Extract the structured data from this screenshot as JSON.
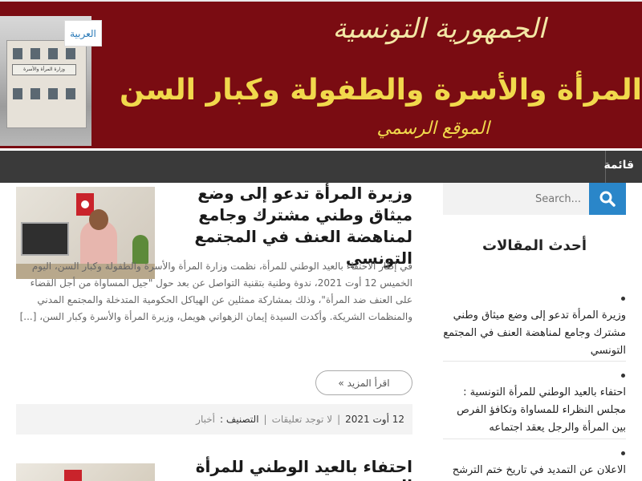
{
  "header": {
    "lang_button": "العربية",
    "title_line1": "الجمهورية التونسية",
    "title_line2": "المرأة والأسرة والطفولة وكبار السن",
    "title_line3": "الموقع الرسمي",
    "building_sign": "وزارة المرأة والأسرة"
  },
  "nav": {
    "menu_label": "قائمة"
  },
  "search": {
    "placeholder": "Search..."
  },
  "sidebar": {
    "heading": "أحدث المقالات",
    "items": [
      {
        "label": "وزيرة المرأة تدعو إلى وضع ميثاق وطني مشترك وجامع لمناهضة العنف في المجتمع التونسي"
      },
      {
        "label": "احتفاء بالعيد الوطني للمرأة التونسية : مجلس النظراء للمساواة وتكافؤ الفرص بين المرأة والرجل يعقد اجتماعه"
      },
      {
        "label": "الاعلان عن التمديد في تاريخ ختم الترشح"
      }
    ]
  },
  "articles": [
    {
      "title": "وزيرة المرأة تدعو إلى وضع ميثاق وطني مشترك وجامع لمناهضة العنف في المجتمع التونسي",
      "excerpt": "في إطار الاحتفاء بالعيد الوطني للمرأة، نظمت وزارة المرأة والأسرة والطفولة وكبار السن، اليوم الخميس 12 أوت 2021، ندوة وطنية بتقنية التواصل عن بعد حول \"جيل المساواة من أجل القضاء على العنف ضد المرأة\"، وذلك بمشاركة ممثلين عن الهياكل الحكومية المتدخلة والمجتمع المدني والمنظمات الشريكة. وأكدت السيدة إيمان الزهواني هويمل، وزيرة المرأة والأسرة وكبار السن، [...]",
      "read_more": "اقرأ المزيد »",
      "date": "12 أوت 2021",
      "comments": "لا توجد تعليقات",
      "category_label": "التصنيف :",
      "category": "أخبار"
    },
    {
      "title": "احتفاء بالعيد الوطني للمرأة التونسية"
    }
  ]
}
